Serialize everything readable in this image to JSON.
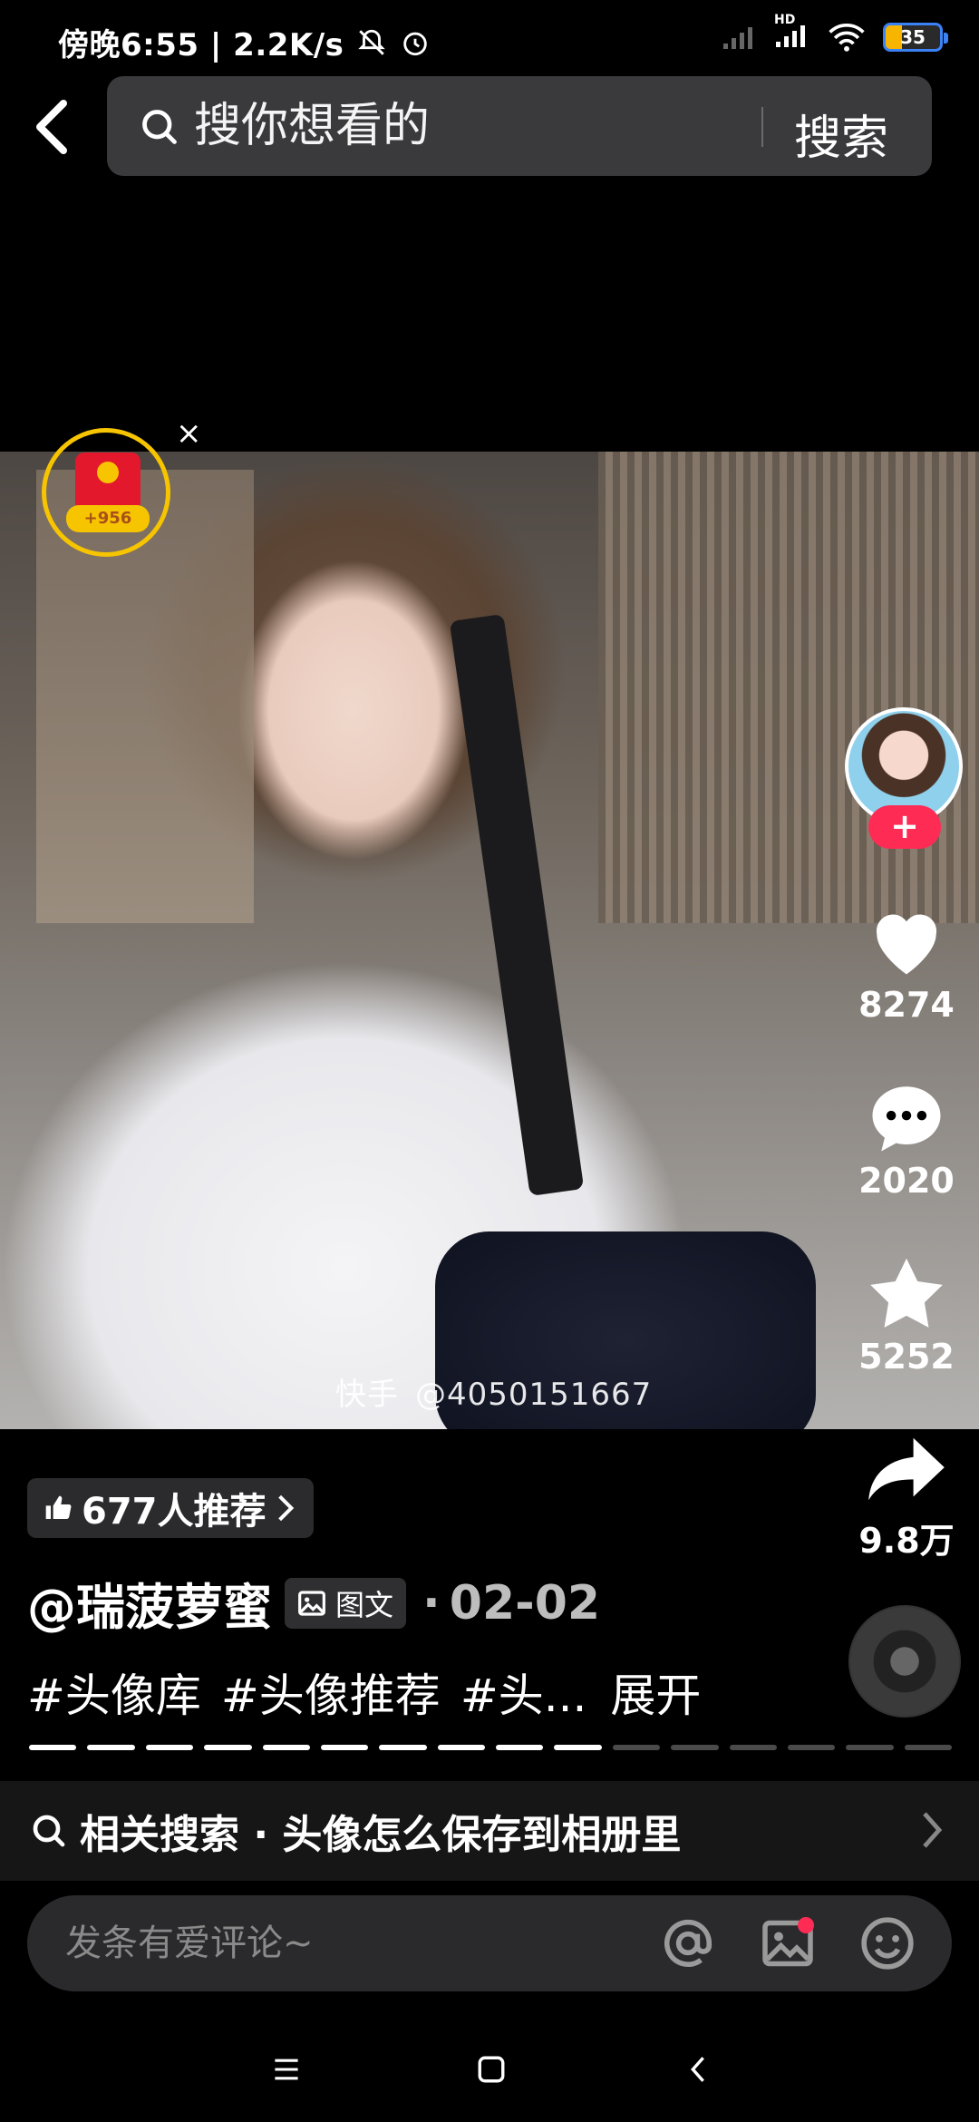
{
  "status_bar": {
    "time_text": "傍晚6:55 | 2.2K/s",
    "battery": "35",
    "hd_label": "HD"
  },
  "search": {
    "placeholder": "搜你想看的",
    "submit_label": "搜索"
  },
  "photo": {
    "watermark_brand": "快手",
    "watermark_id": "@4050151667"
  },
  "red_packet": {
    "count": "+956",
    "close_label": "×"
  },
  "rail": {
    "follow_label": "+",
    "likes": "8274",
    "comments": "2020",
    "favorites": "5252",
    "shares": "9.8万"
  },
  "post": {
    "recommend_text": "677人推荐",
    "author": "@瑞菠萝蜜",
    "type_label": "图文",
    "date_sep": "·",
    "date": "02-02",
    "hashtags": [
      "#头像库",
      "#头像推荐",
      "#头..."
    ],
    "expand_label": "展开",
    "progress_total": 16,
    "progress_current": 10
  },
  "related": {
    "label": "相关搜索 · 头像怎么保存到相册里"
  },
  "comment": {
    "placeholder": "发条有爱评论~"
  },
  "icons": {
    "back": "chevron-left-icon",
    "search": "search-icon",
    "like": "heart-icon",
    "comment": "speech-bubble-icon",
    "favorite": "star-icon",
    "share": "share-arrow-icon",
    "mention": "at-icon",
    "image": "image-icon",
    "emoji": "emoji-icon"
  },
  "colors": {
    "accent": "#fe2c55",
    "gold": "#f7c400"
  }
}
